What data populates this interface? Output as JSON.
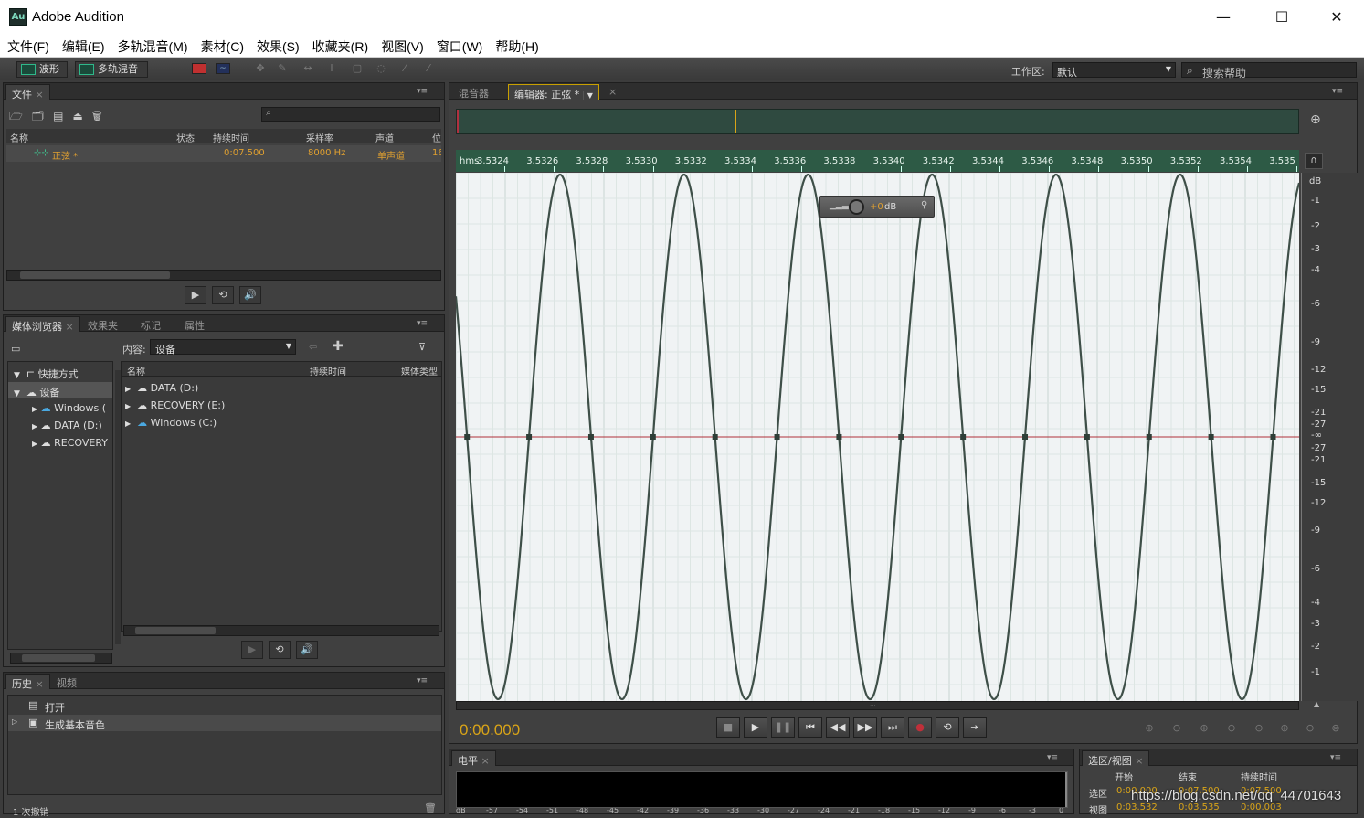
{
  "window": {
    "title": "Adobe Audition",
    "logo_text": "Au"
  },
  "window_controls": {
    "min": "—",
    "max": "☐",
    "close": "✕"
  },
  "menu": [
    "文件(F)",
    "编辑(E)",
    "多轨混音(M)",
    "素材(C)",
    "效果(S)",
    "收藏夹(R)",
    "视图(V)",
    "窗口(W)",
    "帮助(H)"
  ],
  "toolbar": {
    "waveform_label": "波形",
    "multitrack_label": "多轨混音",
    "workspace_label": "工作区:",
    "workspace_value": "默认",
    "help_search_placeholder": "搜索帮助"
  },
  "files_panel": {
    "tab": "文件",
    "columns": [
      "名称",
      "状态",
      "持续时间",
      "采样率",
      "声道",
      "位"
    ],
    "rows": [
      {
        "name": "正弦 *",
        "status": "",
        "duration": "0:07.500",
        "sample_rate": "8000 Hz",
        "channels": "单声道",
        "bits": "16"
      }
    ]
  },
  "media_panel": {
    "tabs": [
      "媒体浏览器",
      "效果夹",
      "标记",
      "属性"
    ],
    "content_label": "内容:",
    "content_value": "设备",
    "tree": [
      {
        "label": "快捷方式",
        "expanded": true,
        "level": 0
      },
      {
        "label": "设备",
        "expanded": true,
        "level": 0,
        "selected": true
      },
      {
        "label": "Windows (",
        "level": 1
      },
      {
        "label": "DATA (D:)",
        "level": 1
      },
      {
        "label": "RECOVERY",
        "level": 1
      }
    ],
    "list_columns": [
      "名称",
      "持续时间",
      "媒体类型"
    ],
    "list_rows": [
      "DATA (D:)",
      "RECOVERY (E:)",
      "Windows (C:)"
    ]
  },
  "history_panel": {
    "tabs": [
      "历史",
      "视频"
    ],
    "items": [
      "打开",
      "生成基本音色"
    ],
    "undo_count": "1 次撤销"
  },
  "editor": {
    "tabs": [
      "混音器",
      "编辑器: 正弦 *"
    ],
    "time_ruler_prefix": "hms",
    "time_ticks": [
      "3.5324",
      "3.5326",
      "3.5328",
      "3.5330",
      "3.5332",
      "3.5334",
      "3.5336",
      "3.5338",
      "3.5340",
      "3.5342",
      "3.5344",
      "3.5346",
      "3.5348",
      "3.5350",
      "3.5352",
      "3.5354",
      "3.535"
    ],
    "db_unit": "dB",
    "db_ticks_top": [
      "-1",
      "-2",
      "-3",
      "-4",
      "-6",
      "-9",
      "-12",
      "-15",
      "-21",
      "-27"
    ],
    "db_center": "-∞",
    "db_ticks_bottom": [
      "-27",
      "-21",
      "-15",
      "-12",
      "-9",
      "-6",
      "-4",
      "-3",
      "-2",
      "-1"
    ],
    "hud_gain": "+0",
    "hud_unit": "dB",
    "current_time": "0:00.000",
    "sine_periods_visible": 6.8,
    "playhead_overview_fraction": 0.33
  },
  "transport": [
    "■",
    "▶",
    "❚❚",
    "⏮",
    "◀◀",
    "▶▶",
    "⏭",
    "●",
    "⟲",
    "⇥"
  ],
  "level_panel": {
    "tab": "电平",
    "scale": [
      "dB",
      "-57",
      "-54",
      "-51",
      "-48",
      "-45",
      "-42",
      "-39",
      "-36",
      "-33",
      "-30",
      "-27",
      "-24",
      "-21",
      "-18",
      "-15",
      "-12",
      "-9",
      "-6",
      "-3",
      "0"
    ]
  },
  "selection_panel": {
    "tab": "选区/视图",
    "columns": [
      "开始",
      "结束",
      "持续时间"
    ],
    "rows": [
      {
        "label": "选区",
        "start": "0:00.000",
        "end": "0:07.500",
        "duration": "0:07.500"
      },
      {
        "label": "视图",
        "start": "0:03.532",
        "end": "0:03.535",
        "duration": "0:00.003"
      }
    ]
  },
  "watermark": "https://blog.csdn.net/qq_44701643",
  "colors": {
    "wave": "#3e4f48",
    "bg_wave": "#f0f3f4",
    "ruler": "#2d5a45",
    "time_accent": "#d9a418",
    "center_line": "#b0303a"
  }
}
